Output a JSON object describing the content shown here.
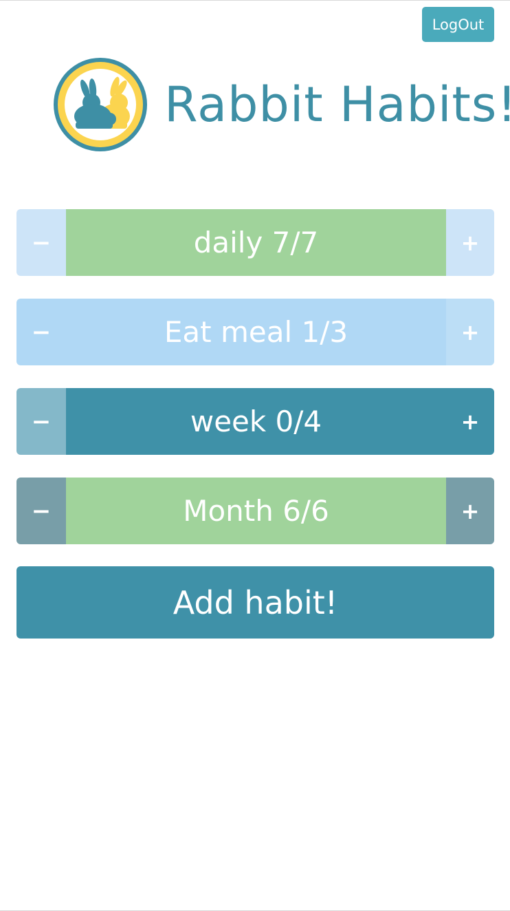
{
  "header": {
    "logout_label": "LogOut",
    "title": "Rabbit Habits!"
  },
  "colors": {
    "brand_teal": "#3e8fa5",
    "logout_bg": "#4aaabb",
    "logo_ring": "#3e8fa5",
    "logo_fill": "#fbd44f",
    "complete_green": "#a0d39b"
  },
  "habits": [
    {
      "label": "daily 7/7",
      "minus": "−",
      "plus": "+",
      "minus_color": "#cde4f8",
      "label_color": "#a0d39b",
      "plus_color": "#cde4f8"
    },
    {
      "label": "Eat meal 1/3",
      "minus": "−",
      "plus": "+",
      "minus_color": "#b0d8f5",
      "label_color": "#b0d8f5",
      "plus_color": "#bcdef6"
    },
    {
      "label": "week 0/4",
      "minus": "−",
      "plus": "+",
      "minus_color": "#84b8c9",
      "label_color": "#3f91a8",
      "plus_color": "#3f91a8"
    },
    {
      "label": "Month 6/6",
      "minus": "−",
      "plus": "+",
      "minus_color": "#789ea8",
      "label_color": "#a0d39b",
      "plus_color": "#789ea8"
    }
  ],
  "add_habit_label": "Add habit!"
}
